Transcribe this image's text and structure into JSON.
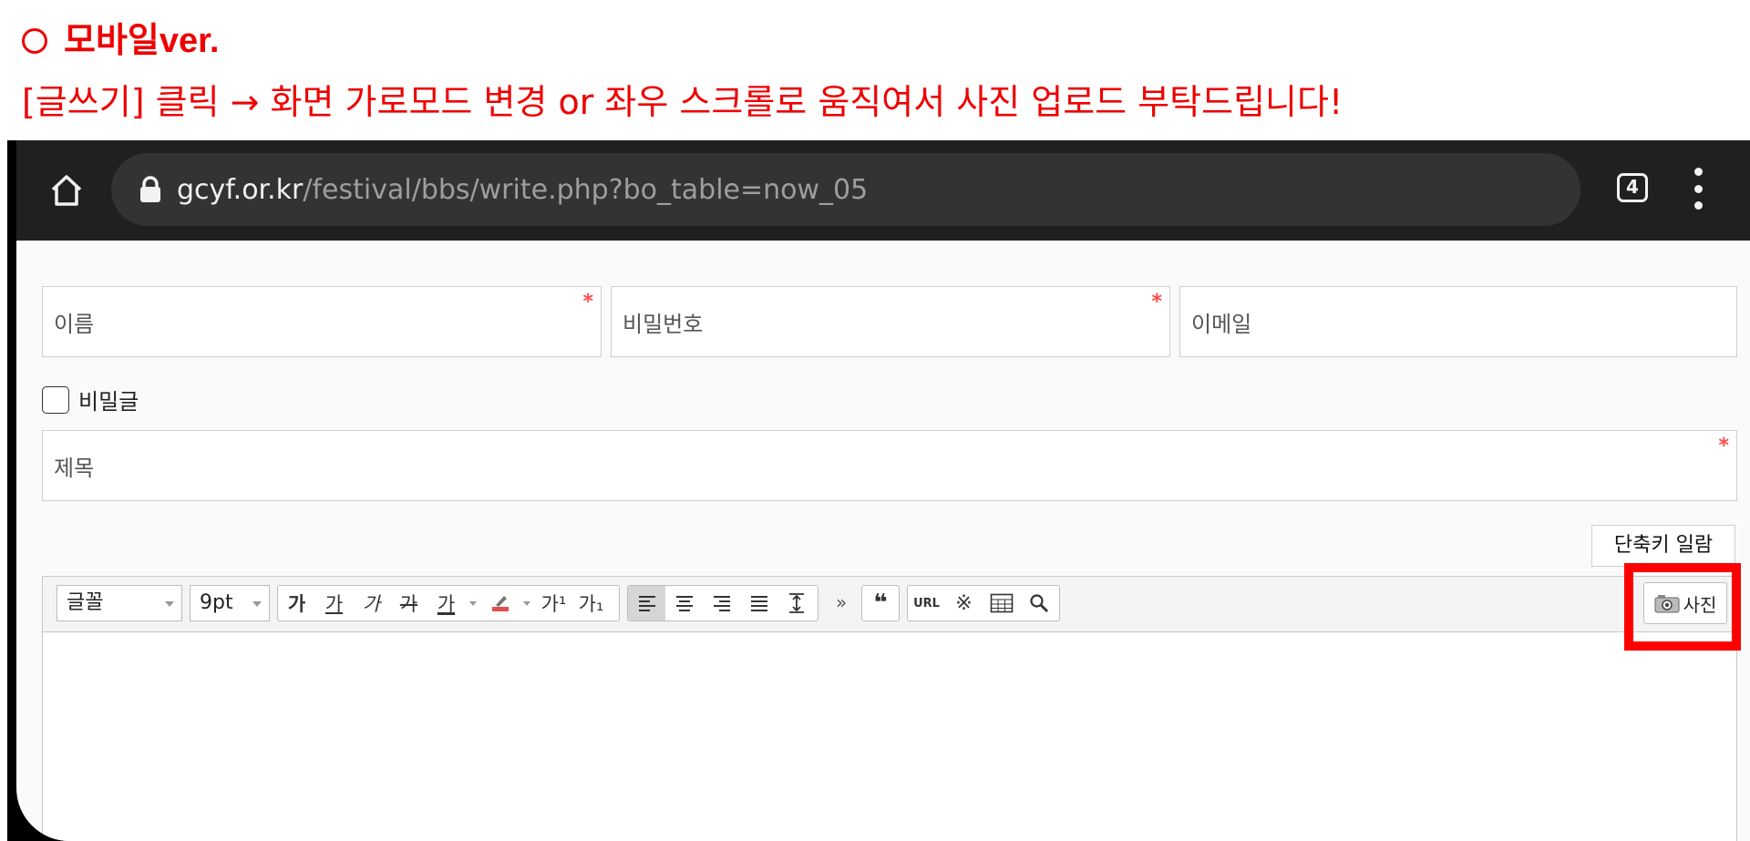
{
  "headline": {
    "title": "모바일ver."
  },
  "instruction": "[글쓰기] 클릭 → 화면 가로모드 변경 or 좌우 스크롤로 움직여서 사진 업로드 부탁드립니다!",
  "browser": {
    "url_host": "gcyf.or.kr",
    "url_path": "/festival/bbs/write.php?bo_table=now_05",
    "tab_count": "4",
    "icons": [
      "home-icon",
      "lock-icon",
      "tabs-icon",
      "more-vertical-icon"
    ]
  },
  "form": {
    "name_placeholder": "이름",
    "password_placeholder": "비밀번호",
    "email_placeholder": "이메일",
    "secret_label": "비밀글",
    "subject_placeholder": "제목",
    "required_mark": "*",
    "shortcut_button": "단축키 일람"
  },
  "editor": {
    "font_select": "글꼴",
    "size_select": "9pt",
    "photo_button": "사진",
    "tools": {
      "bold": "가",
      "underline": "가",
      "italic": "가",
      "strike": "가",
      "font_color": "가",
      "superscript": "가¹",
      "subscript": "가₁",
      "url": "URL",
      "quote": "❝",
      "more": "»"
    }
  },
  "colors": {
    "annotation_red": "#ee0000",
    "highlight_box": "#ff0000",
    "required_star": "#ff4a4a",
    "browser_bar": "#202020"
  }
}
